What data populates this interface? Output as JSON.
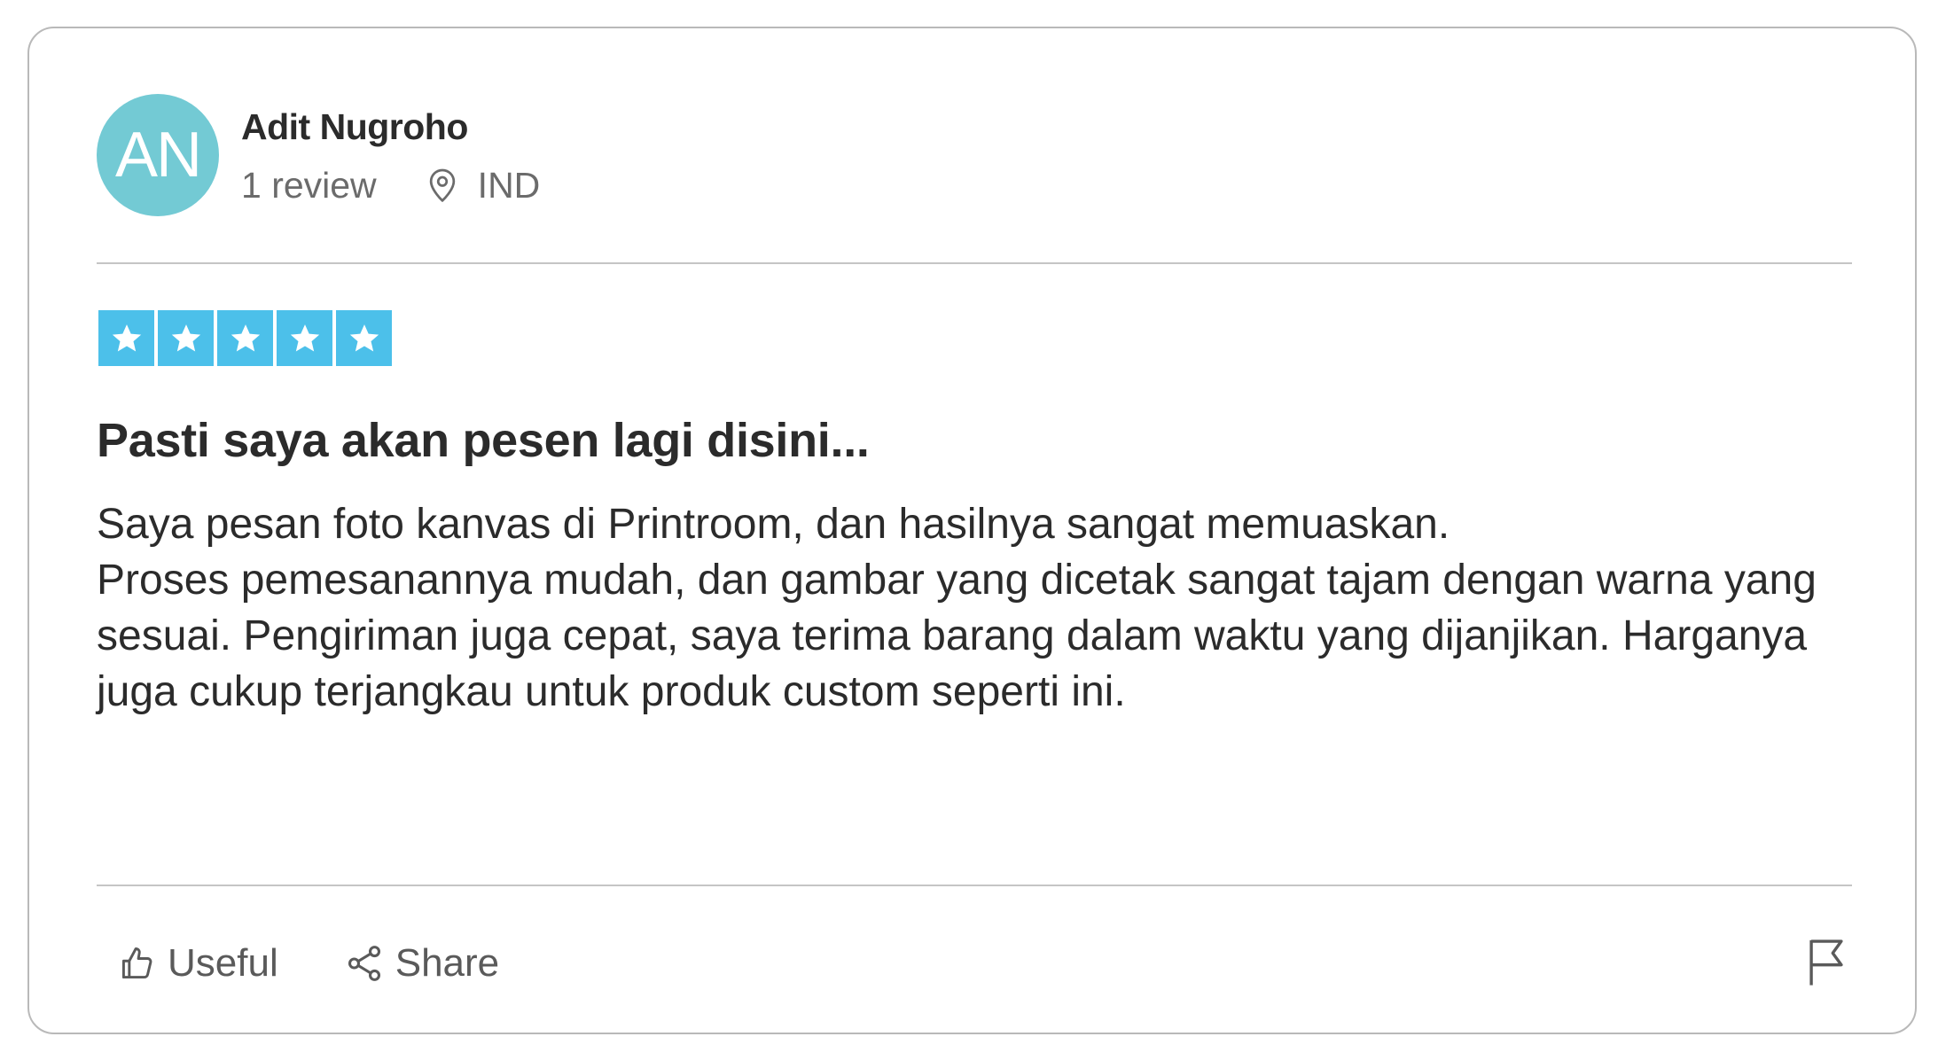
{
  "reviewer": {
    "initials": "AN",
    "name": "Adit Nugroho",
    "review_count": "1 review",
    "location": "IND",
    "avatar_color": "#73cad4"
  },
  "rating": {
    "stars": 5,
    "max": 5,
    "star_color": "#4cc0ea"
  },
  "review": {
    "title": "Pasti saya akan pesen lagi disini...",
    "body_lines": [
      "Saya pesan foto kanvas di Printroom, dan hasilnya sangat memuaskan.",
      "Proses pemesanannya mudah, dan gambar yang dicetak sangat tajam dengan warna yang sesuai. Pengiriman juga cepat, saya terima barang dalam waktu yang dijanjikan. Harganya juga cukup terjangkau untuk produk custom seperti ini."
    ]
  },
  "actions": {
    "useful_label": "Useful",
    "share_label": "Share",
    "useful_icon": "thumbs-up-icon",
    "share_icon": "share-icon",
    "report_icon": "flag-icon"
  }
}
